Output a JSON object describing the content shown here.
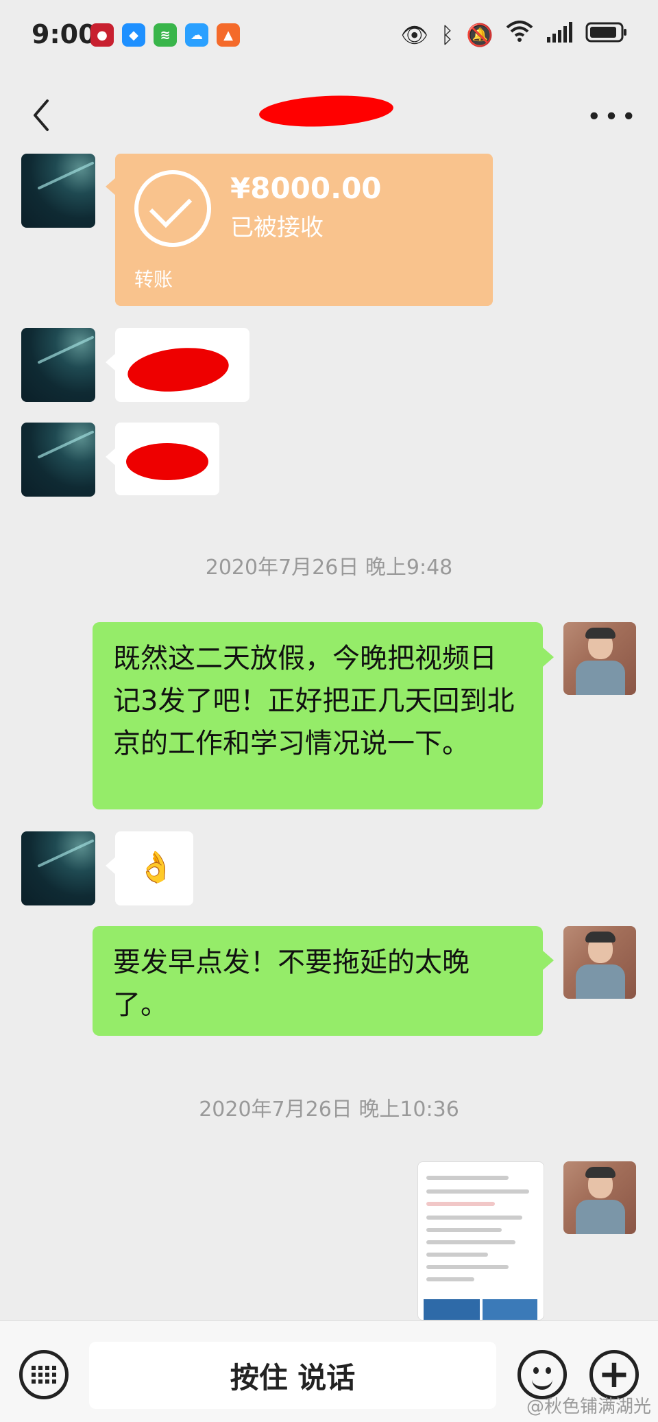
{
  "status_bar": {
    "time": "9:00",
    "app_icons": [
      {
        "name": "bank-app-icon",
        "color": "#c8202f"
      },
      {
        "name": "chat-app-icon",
        "color": "#1e90ff"
      },
      {
        "name": "wifi-app-icon",
        "color": "#39b54a"
      },
      {
        "name": "cloud-app-icon",
        "color": "#2aa0ff"
      },
      {
        "name": "sky-app-icon",
        "color": "#f46a2a"
      }
    ],
    "system_icons": [
      "eye-icon",
      "bluetooth-icon",
      "mute-icon",
      "wifi-icon",
      "signal-icon",
      "battery-icon"
    ]
  },
  "header": {
    "title": "",
    "back_icon": "chevron-left-icon",
    "more_icon": "more-dots-icon"
  },
  "messages": {
    "transfer": {
      "amount": "¥8000.00",
      "status": "已被接收",
      "label": "转账"
    },
    "timestamp1": "2020年7月26日 晚上9:48",
    "text1": "既然这二天放假，今晚把视频日记3发了吧！正好把正几天回到北京的工作和学习情况说一下。",
    "ok_emoji": "👌",
    "text2": "要发早点发！不要拖延的太晚了。",
    "timestamp2": "2020年7月26日 晚上10:36"
  },
  "input_bar": {
    "voice_label": "按住 说话",
    "keyboard_icon": "keyboard-icon",
    "emoji_icon": "emoji-icon",
    "plus_icon": "plus-icon"
  },
  "watermark": "@秋色铺满湖光",
  "colors": {
    "background": "#ededed",
    "green_bubble": "#95ec69",
    "transfer_bubble": "#f9c38d",
    "redaction": "#ee0000"
  }
}
